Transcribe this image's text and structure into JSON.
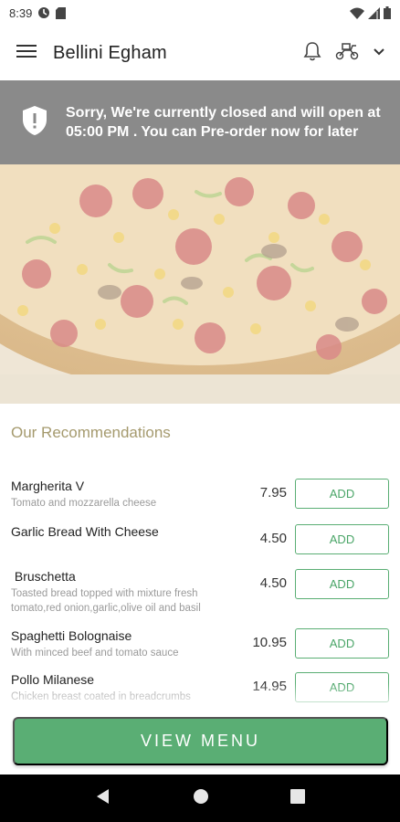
{
  "status_bar": {
    "time": "8:39",
    "icons": [
      "data-saver-icon",
      "sim-card-icon",
      "wifi-icon",
      "signal-icon",
      "battery-icon"
    ]
  },
  "app_bar": {
    "title": "Bellini Egham",
    "icons": [
      "menu-icon",
      "bell-icon",
      "delivery-scooter-icon",
      "chevron-down-icon"
    ]
  },
  "banner": {
    "message": "Sorry, We're currently closed and will open at 05:00 PM . You can Pre-order now for later",
    "icon": "shield-alert-icon"
  },
  "recommendations": {
    "title": "Our Recommendations",
    "items": [
      {
        "name": "Margherita V",
        "description": "Tomato and mozzarella cheese",
        "price": "7.95",
        "button": "ADD"
      },
      {
        "name": "Garlic Bread With Cheese",
        "description": "",
        "price": "4.50",
        "button": "ADD"
      },
      {
        "name": " Bruschetta",
        "description": "Toasted bread topped with mixture fresh tomato,red onion,garlic,olive oil and basil",
        "price": "4.50",
        "button": "ADD"
      },
      {
        "name": "Spaghetti Bolognaise",
        "description": "With minced beef and tomato sauce",
        "price": "10.95",
        "button": "ADD"
      },
      {
        "name": "Pollo Milanese",
        "description": "Chicken breast coated in breadcrumbs",
        "price": "14.95",
        "button": "ADD"
      }
    ]
  },
  "footer": {
    "view_menu": "VIEW MENU"
  },
  "nav_bar": {
    "icons": [
      "back-icon",
      "home-icon",
      "recents-icon"
    ]
  },
  "colors": {
    "accent_green": "#5aae74",
    "banner_gray": "#8a8a8a",
    "section_title": "#a59a6e"
  }
}
